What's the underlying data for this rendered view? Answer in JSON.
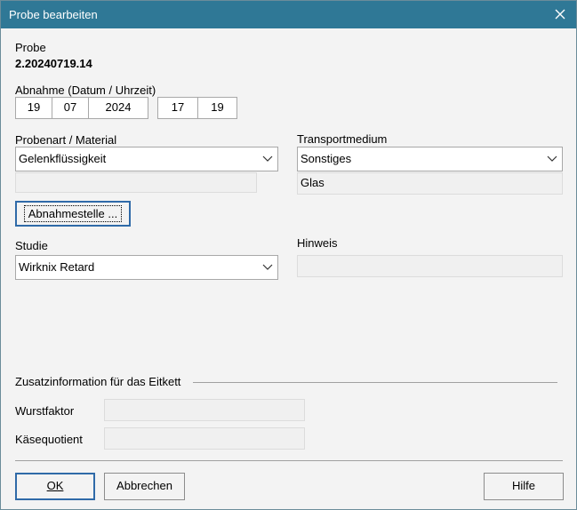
{
  "window": {
    "title": "Probe bearbeiten",
    "close_icon": "close-icon"
  },
  "probe": {
    "label": "Probe",
    "value": "2.20240719.14"
  },
  "abnahme": {
    "label": "Abnahme (Datum / Uhrzeit)",
    "day": "19",
    "month": "07",
    "year": "2024",
    "hour": "17",
    "minute": "19"
  },
  "probenart": {
    "label": "Probenart / Material",
    "selected": "Gelenkflüssigkeit",
    "extra": ""
  },
  "transport": {
    "label": "Transportmedium",
    "selected": "Sonstiges",
    "extra": "Glas"
  },
  "abnahmestelle_button": "Abnahmestelle ...",
  "studie": {
    "label": "Studie",
    "selected": "Wirknix Retard"
  },
  "hinweis": {
    "label": "Hinweis",
    "value": ""
  },
  "zusatz": {
    "heading": "Zusatzinformation für das Eitkett",
    "wurstfaktor_label": "Wurstfaktor",
    "wurstfaktor_value": "",
    "kaesequotient_label": "Käsequotient",
    "kaesequotient_value": ""
  },
  "buttons": {
    "ok": "OK",
    "cancel": "Abbrechen",
    "help": "Hilfe"
  }
}
